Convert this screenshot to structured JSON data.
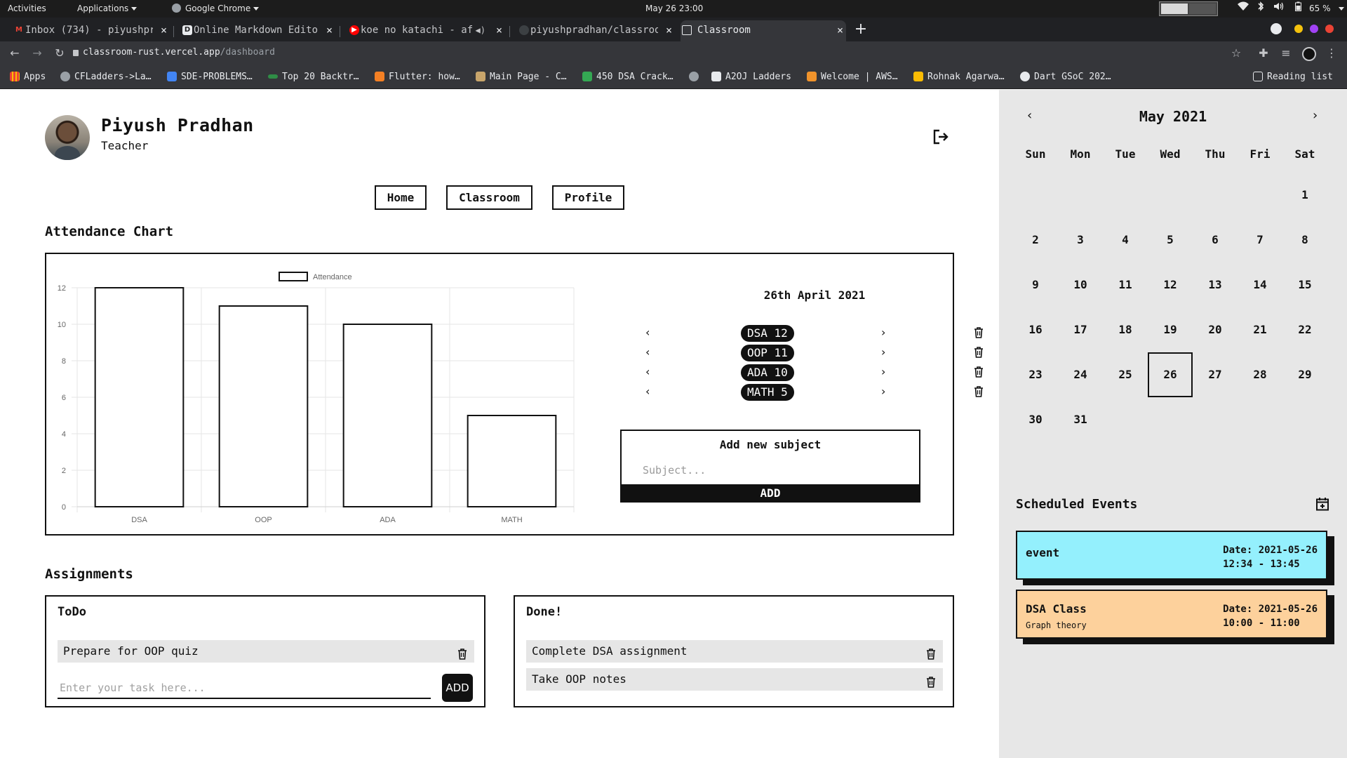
{
  "os": {
    "activities": "Activities",
    "applications": "Applications",
    "app": "Google Chrome",
    "clock": "May 26 23:00",
    "battery": "65 %"
  },
  "tabs": [
    {
      "label": "Inbox (734) - piyushpr",
      "icon": "gmail-icon"
    },
    {
      "label": "Online Markdown Editor",
      "icon": "d-icon"
    },
    {
      "label": "koe no katachi - af",
      "icon": "youtube-icon"
    },
    {
      "label": "piyushpradhan/classroo",
      "icon": "github-icon"
    },
    {
      "label": "Classroom",
      "icon": "page-icon"
    }
  ],
  "toolbar": {
    "url_host": "classroom-rust.vercel.app",
    "url_path": "/dashboard"
  },
  "bookmarks": [
    {
      "label": "Apps",
      "color": "#ea4335"
    },
    {
      "label": "CFLadders->La…",
      "color": "#9aa0a6"
    },
    {
      "label": "SDE-PROBLEMS…",
      "color": "#4285f4"
    },
    {
      "label": "Top 20 Backtr…",
      "color": "#2f8d46"
    },
    {
      "label": "Flutter: how…",
      "color": "#f48024"
    },
    {
      "label": "Main Page - C…",
      "color": "#c8a56b"
    },
    {
      "label": "450 DSA Crack…",
      "color": "#34a853"
    },
    {
      "label": "",
      "color": "#9aa0a6"
    },
    {
      "label": "A2OJ Ladders",
      "color": "#e8eaed"
    },
    {
      "label": "Welcome | AWS…",
      "color": "#f0932b"
    },
    {
      "label": "Rohnak Agarwa…",
      "color": "#fbbc04"
    },
    {
      "label": "Dart GSoC 202…",
      "color": "#e8eaed"
    }
  ],
  "reading_list": "Reading list",
  "profile": {
    "name": "Piyush Pradhan",
    "role": "Teacher"
  },
  "nav": [
    "Home",
    "Classroom",
    "Profile"
  ],
  "attendance": {
    "title": "Attendance Chart",
    "date": "26th April 2021",
    "subjects": [
      {
        "name": "DSA",
        "count": "12",
        "label": "DSA 12"
      },
      {
        "name": "OOP",
        "count": "11",
        "label": "OOP 11"
      },
      {
        "name": "ADA",
        "count": "10",
        "label": "ADA 10"
      },
      {
        "name": "MATH",
        "count": "5",
        "label": "MATH 5"
      }
    ],
    "add_title": "Add new subject",
    "add_placeholder": "Subject...",
    "add_button": "ADD"
  },
  "chart_data": {
    "type": "bar",
    "categories": [
      "DSA",
      "OOP",
      "ADA",
      "MATH"
    ],
    "series": [
      {
        "name": "Attendance",
        "values": [
          12,
          11,
          10,
          5
        ]
      }
    ],
    "ylim": [
      0,
      12
    ],
    "yticks": [
      "0",
      "2",
      "4",
      "6",
      "8",
      "10",
      "12"
    ],
    "legend": "top-center",
    "grid": true
  },
  "assignments": {
    "title": "Assignments",
    "todo": {
      "title": "ToDo",
      "items": [
        "Prepare for OOP quiz"
      ],
      "placeholder": "Enter your task here...",
      "add_label": "ADD"
    },
    "done": {
      "title": "Done!",
      "items": [
        "Complete DSA assignment",
        "Take OOP notes"
      ]
    }
  },
  "calendar": {
    "month": "May 2021",
    "dow": [
      "Sun",
      "Mon",
      "Tue",
      "Wed",
      "Thu",
      "Fri",
      "Sat"
    ],
    "first_weekday": 6,
    "days_in_month": 31,
    "today": 26
  },
  "scheduled": {
    "title": "Scheduled Events",
    "events": [
      {
        "name": "event",
        "sub": "",
        "date": "Date: 2021-05-26",
        "time": "12:34 - 13:45",
        "color": "#94f0fd"
      },
      {
        "name": "DSA Class",
        "sub": "Graph theory",
        "date": "Date: 2021-05-26",
        "time": "10:00 - 11:00",
        "color": "#fdd19c"
      }
    ]
  }
}
